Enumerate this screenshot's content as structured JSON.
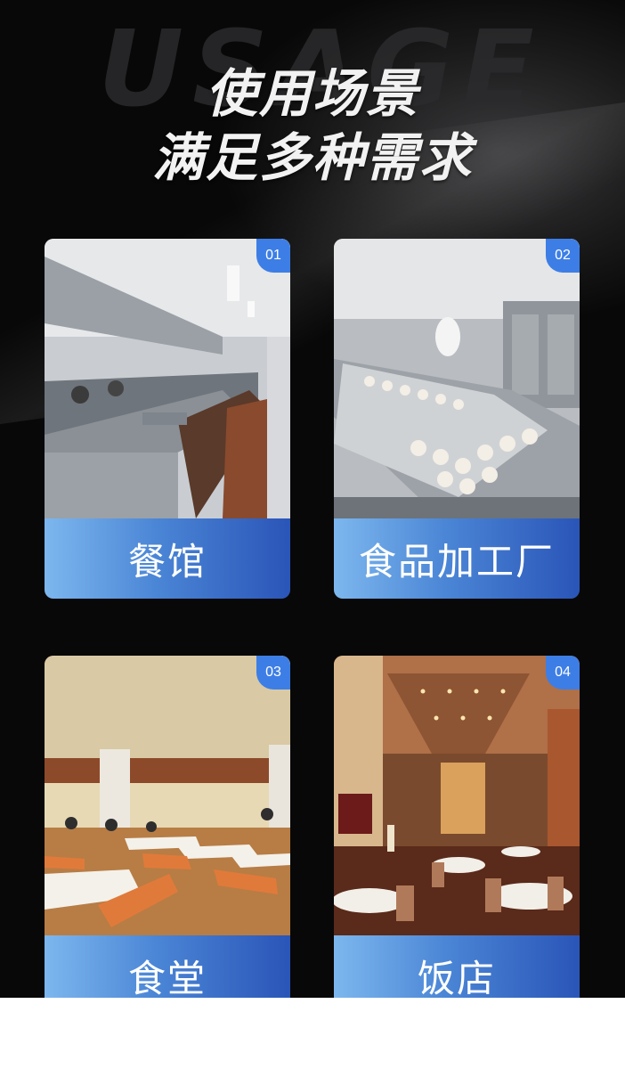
{
  "header": {
    "watermark": "USAGE",
    "title_line1": "使用场景",
    "title_line2": "满足多种需求"
  },
  "cards": [
    {
      "number": "01",
      "label": "餐馆"
    },
    {
      "number": "02",
      "label": "食品加工厂"
    },
    {
      "number": "03",
      "label": "食堂"
    },
    {
      "number": "04",
      "label": "饭店"
    }
  ],
  "colors": {
    "background": "#070707",
    "caption_gradient_start": "#7db7ee",
    "caption_gradient_end": "#2a55b8",
    "badge": "#3d7ee6"
  }
}
